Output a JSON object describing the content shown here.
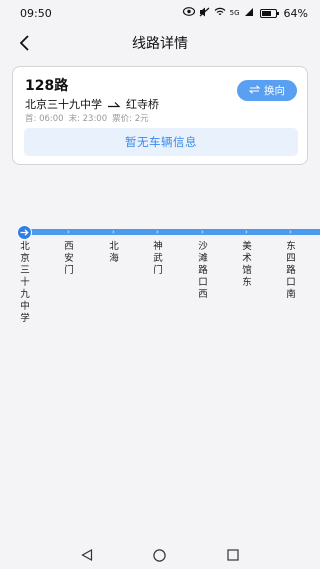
{
  "status_bar": {
    "time": "09:50",
    "network": "5G",
    "battery": "64%"
  },
  "header": {
    "title": "线路详情"
  },
  "route": {
    "name": "128路",
    "from": "北京三十九中学",
    "to": "红寺桥",
    "first_bus": "首: 06:00",
    "last_bus": "末: 23:00",
    "fare": "票价: 2元",
    "switch_label": "换向",
    "no_vehicle_text": "暂无车辆信息"
  },
  "stops": [
    {
      "name": "北京三十九中学"
    },
    {
      "name": "西安门"
    },
    {
      "name": "北海"
    },
    {
      "name": "神武门"
    },
    {
      "name": "沙滩路口西"
    },
    {
      "name": "美术馆东"
    },
    {
      "name": "东四路口南"
    }
  ],
  "colors": {
    "accent": "#4a9af0",
    "accent_dark": "#2f7fe6",
    "info_bg": "#e8f1fc"
  }
}
